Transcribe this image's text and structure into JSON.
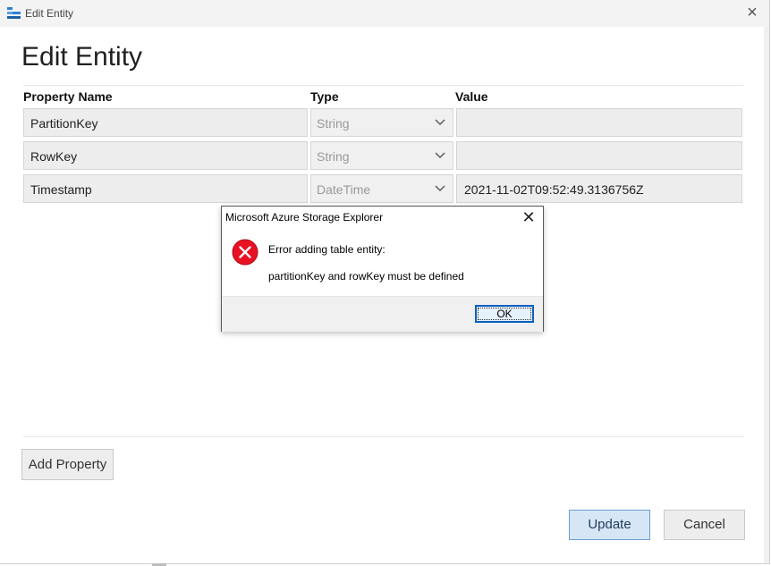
{
  "window": {
    "title": "Edit Entity",
    "close_glyph": "×"
  },
  "heading": "Edit Entity",
  "columns": {
    "name": "Property Name",
    "type": "Type",
    "value": "Value"
  },
  "properties": [
    {
      "name": "PartitionKey",
      "type": "String",
      "value": ""
    },
    {
      "name": "RowKey",
      "type": "String",
      "value": ""
    },
    {
      "name": "Timestamp",
      "type": "DateTime",
      "value": "2021-11-02T09:52:49.3136756Z"
    }
  ],
  "dialog": {
    "title": "Microsoft Azure Storage Explorer",
    "close_glyph": "✕",
    "icon": "error-icon",
    "message_line1": "Error adding table entity:",
    "message_line2": "partitionKey and rowKey must be defined",
    "ok_label": "OK"
  },
  "buttons": {
    "add_property": "Add Property",
    "update": "Update",
    "cancel": "Cancel"
  },
  "colors": {
    "error_red": "#e81123",
    "primary_button": "#d6e6f5",
    "focus_border": "#0a5fbf"
  }
}
